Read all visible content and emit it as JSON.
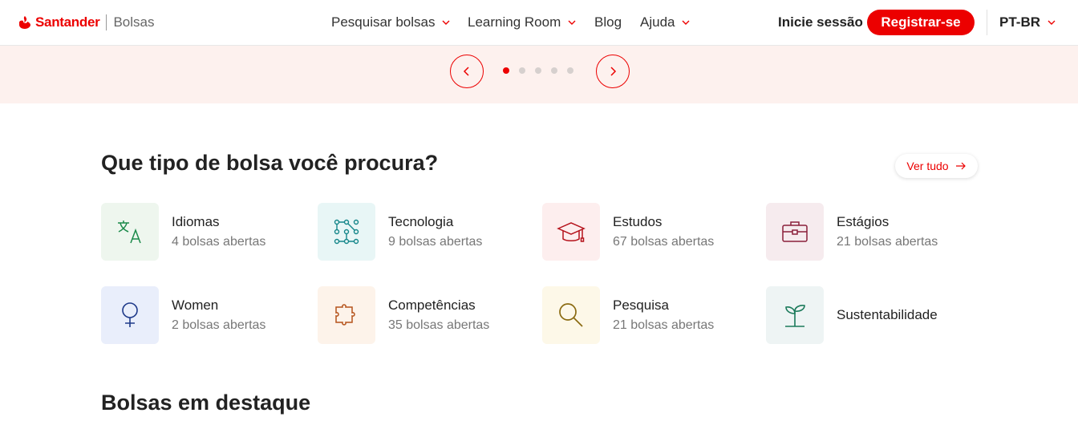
{
  "header": {
    "brand": "Santander",
    "product": "Bolsas",
    "nav": [
      {
        "label": "Pesquisar bolsas",
        "has_dropdown": true
      },
      {
        "label": "Learning Room",
        "has_dropdown": true
      },
      {
        "label": "Blog",
        "has_dropdown": false
      },
      {
        "label": "Ajuda",
        "has_dropdown": true
      }
    ],
    "login_label": "Inicie sessão",
    "register_label": "Registrar-se",
    "language": "PT-BR"
  },
  "carousel": {
    "prev_icon": "chevron-left-icon",
    "next_icon": "chevron-right-icon",
    "slide_count": 5,
    "active_slide": 1
  },
  "categories_section": {
    "title": "Que tipo de bolsa você procura?",
    "see_all_label": "Ver tudo",
    "items": [
      {
        "name": "Idiomas",
        "count": "4 bolsas abertas",
        "icon": "translate-icon"
      },
      {
        "name": "Tecnologia",
        "count": "9 bolsas abertas",
        "icon": "network-icon"
      },
      {
        "name": "Estudos",
        "count": "67 bolsas abertas",
        "icon": "graduation-cap-icon"
      },
      {
        "name": "Estágios",
        "count": "21 bolsas abertas",
        "icon": "briefcase-icon"
      },
      {
        "name": "Women",
        "count": "2 bolsas abertas",
        "icon": "female-symbol-icon"
      },
      {
        "name": "Competências",
        "count": "35 bolsas abertas",
        "icon": "puzzle-icon"
      },
      {
        "name": "Pesquisa",
        "count": "21 bolsas abertas",
        "icon": "magnifier-icon"
      },
      {
        "name": "Sustentabilidade",
        "count": "",
        "icon": "sprout-icon"
      }
    ]
  },
  "featured_section": {
    "title": "Bolsas em destaque"
  },
  "colors": {
    "brand_red": "#ec0000",
    "hero_bg": "#fdf1ee"
  }
}
